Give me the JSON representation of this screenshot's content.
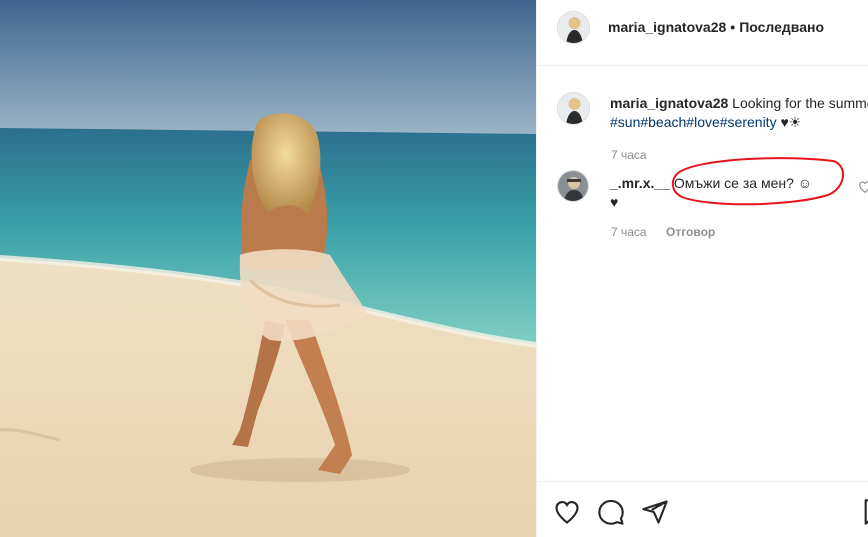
{
  "post": {
    "author": "maria_ignatova28",
    "separator": "•",
    "follow_label": "Последвано"
  },
  "caption": {
    "username": "maria_ignatova28",
    "text": " Looking for the summer",
    "hashtags": [
      "#sun",
      "#beach",
      "#love",
      "#serenity"
    ],
    "trailing": " ♥☀",
    "time": "7 часа"
  },
  "comment": {
    "username": "_.mr.x.__",
    "text": " Омъжи се за мен? ☺",
    "extra": "♥",
    "time": "7 часа",
    "reply_label": "Отговор"
  },
  "colors": {
    "text": "#262626",
    "secondary": "#8e8e8e",
    "hashtag": "#00376b",
    "annotation": "#e8141b"
  },
  "icons": [
    "heart-icon",
    "comment-icon",
    "share-icon",
    "bookmark-icon"
  ]
}
